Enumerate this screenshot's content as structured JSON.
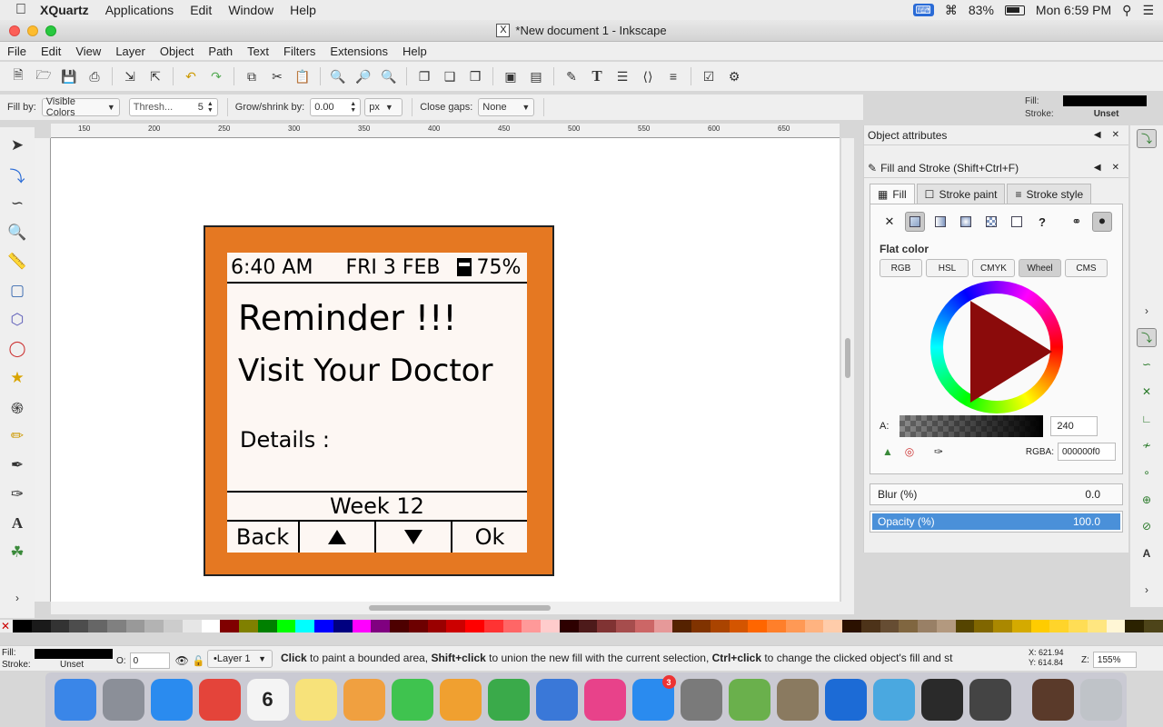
{
  "macmenu": {
    "app": "XQuartz",
    "items": [
      "Applications",
      "Edit",
      "Window",
      "Help"
    ],
    "battery": "83%",
    "clock": "Mon 6:59 PM"
  },
  "window": {
    "title": "*New document 1 - Inkscape"
  },
  "menu": [
    "File",
    "Edit",
    "View",
    "Layer",
    "Object",
    "Path",
    "Text",
    "Filters",
    "Extensions",
    "Help"
  ],
  "controls": {
    "fill_by_label": "Fill by:",
    "fill_by_value": "Visible Colors",
    "threshold_label": "Thresh...",
    "threshold_value": "5",
    "grow_label": "Grow/shrink by:",
    "grow_value": "0.00",
    "unit": "px",
    "close_gaps_label": "Close gaps:",
    "close_gaps_value": "None"
  },
  "indicator": {
    "fill_label": "Fill:",
    "stroke_label": "Stroke:",
    "stroke_value": "Unset"
  },
  "ruler_ticks": [
    "150",
    "200",
    "250",
    "300",
    "350",
    "400",
    "450",
    "500",
    "550",
    "600",
    "650"
  ],
  "device": {
    "time": "6:40 AM",
    "date": "FRI 3 FEB",
    "battery": "75%",
    "title": "Reminder !!!",
    "subtitle": "Visit Your Doctor",
    "details": "Details :",
    "week": "Week 12",
    "back": "Back",
    "ok": "Ok"
  },
  "panels": {
    "object_attributes": "Object attributes",
    "fill_stroke": "Fill and Stroke (Shift+Ctrl+F)",
    "tabs": [
      "Fill",
      "Stroke paint",
      "Stroke style"
    ],
    "flat_color": "Flat color",
    "modes": [
      "RGB",
      "HSL",
      "CMYK",
      "Wheel",
      "CMS"
    ],
    "alpha_label": "A:",
    "alpha_value": "240",
    "rgba_label": "RGBA:",
    "rgba_value": "000000f0",
    "blur_label": "Blur (%)",
    "blur_value": "0.0",
    "opacity_label": "Opacity (%)",
    "opacity_value": "100.0",
    "opacity_fraction": 1.0
  },
  "status": {
    "fill_label": "Fill:",
    "stroke_label": "Stroke:",
    "stroke_value": "Unset",
    "o_label": "O:",
    "o_value": "0",
    "layer": "•Layer 1",
    "message_parts": [
      "Click",
      " to paint a bounded area, ",
      "Shift+click",
      " to union the new fill with the current selection, ",
      "Ctrl+click",
      " to change the clicked object's fill and st"
    ],
    "x_coord": "X: 621.94",
    "y_coord": "Y: 614.84",
    "zoom_label": "Z:",
    "zoom_value": "155%"
  },
  "colors": {
    "device_orange": "#e57822",
    "screen_bg": "#fdf7f3",
    "opacity_blue": "#4a90d9"
  },
  "dock_apps": [
    {
      "name": "Finder",
      "color": "#3a86e8"
    },
    {
      "name": "Launchpad",
      "color": "#8b8f98"
    },
    {
      "name": "Safari",
      "color": "#2a8bef"
    },
    {
      "name": "Chrome",
      "color": "#e4443a"
    },
    {
      "name": "Calendar",
      "color": "#f4f4f4",
      "label": "6"
    },
    {
      "name": "Notes",
      "color": "#f7e27a"
    },
    {
      "name": "Photos",
      "color": "#f0a040"
    },
    {
      "name": "FaceTime",
      "color": "#3fc34f"
    },
    {
      "name": "Pages",
      "color": "#f0a030"
    },
    {
      "name": "Numbers",
      "color": "#3aaa4a"
    },
    {
      "name": "Keynote",
      "color": "#3a78d8"
    },
    {
      "name": "iTunes",
      "color": "#e8428a"
    },
    {
      "name": "App Store",
      "color": "#2a8bef",
      "badge": "3"
    },
    {
      "name": "System Preferences",
      "color": "#7a7a7a"
    },
    {
      "name": "Android Studio",
      "color": "#6ab04c"
    },
    {
      "name": "GIMP",
      "color": "#8a7a60"
    },
    {
      "name": "TeamViewer",
      "color": "#1c6bd6"
    },
    {
      "name": "Notepadqq",
      "color": "#4aa8e0"
    },
    {
      "name": "Inkscape",
      "color": "#2a2a2a"
    },
    {
      "name": "XQuartz",
      "color": "#444444"
    },
    {
      "name": "Document",
      "color": "#5a3a2a"
    },
    {
      "name": "Trash",
      "color": "#bfc3c8"
    }
  ]
}
